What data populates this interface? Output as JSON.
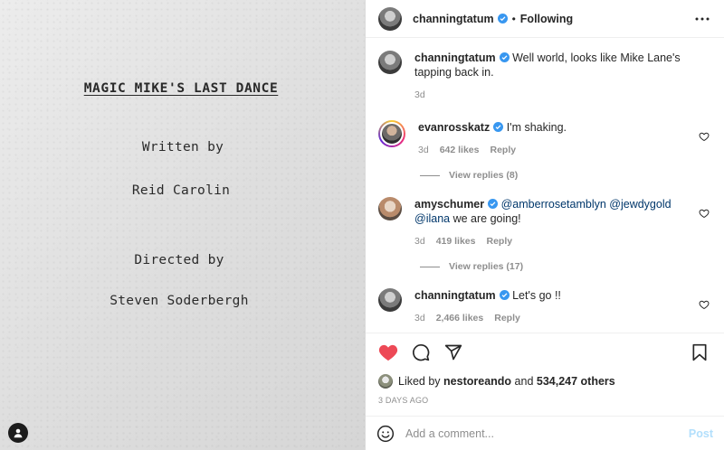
{
  "media": {
    "title": "MAGIC MIKE'S LAST DANCE",
    "line1": "Written by",
    "line2": "Reid Carolin",
    "line3": "Directed by",
    "line4": "Steven Soderbergh",
    "user_icon": "person-icon"
  },
  "header": {
    "username": "channingtatum",
    "dot": "•",
    "following": "Following",
    "more_icon": "more-horizontal-icon"
  },
  "caption": {
    "username": "channingtatum",
    "text": "Well world, looks like Mike Lane's tapping back in.",
    "time": "3d"
  },
  "comments": [
    {
      "username": "evanrosskatz",
      "text": "I'm shaking.",
      "time": "3d",
      "likes": "642 likes",
      "reply": "Reply",
      "view_replies": "View replies (8)"
    },
    {
      "username": "amyschumer",
      "mentions": "@amberrosetamblyn @jewdygold @ilana",
      "text": "we are going!",
      "time": "3d",
      "likes": "419 likes",
      "reply": "Reply",
      "view_replies": "View replies (17)"
    },
    {
      "username": "channingtatum",
      "text": "Let's go !!",
      "time": "3d",
      "likes": "2,466 likes",
      "reply": "Reply"
    }
  ],
  "actions": {
    "like_icon": "heart-filled-icon",
    "comment_icon": "comment-icon",
    "share_icon": "paper-plane-icon",
    "save_icon": "bookmark-icon",
    "like_color": "#ed4956"
  },
  "likes": {
    "prefix": "Liked by",
    "user": "nestoreando",
    "and": "and",
    "others": "534,247 others"
  },
  "date": "3 DAYS AGO",
  "add_comment": {
    "emoji_icon": "emoji-icon",
    "placeholder": "Add a comment...",
    "post_label": "Post"
  },
  "colors": {
    "verified": "#3897f0",
    "secondary_text": "#8e8e8e",
    "post_disabled": "#b2dffc",
    "mention": "#00376b"
  }
}
